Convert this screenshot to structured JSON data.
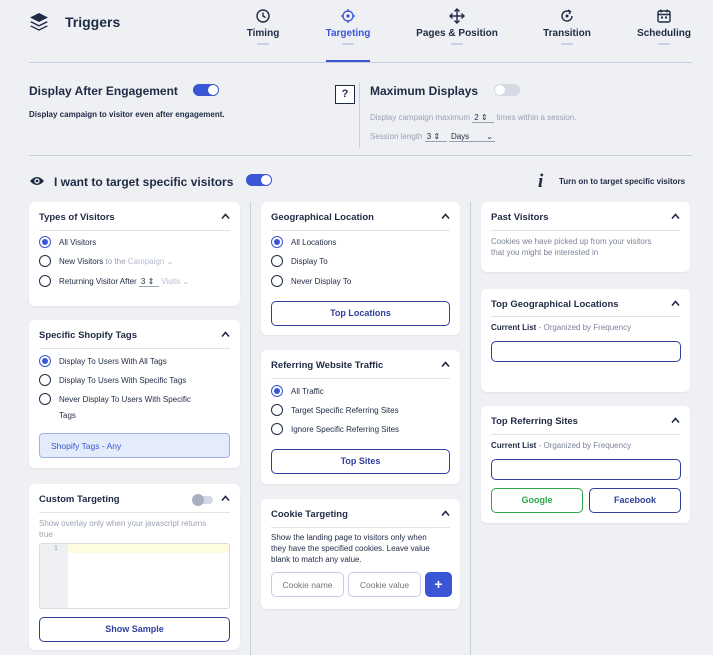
{
  "header": {
    "title": "Triggers",
    "tabs": [
      {
        "label": "Timing"
      },
      {
        "label": "Targeting"
      },
      {
        "label": "Pages & Position"
      },
      {
        "label": "Transition"
      },
      {
        "label": "Scheduling"
      }
    ],
    "active_tab": "Targeting"
  },
  "engagement": {
    "title": "Display After Engagement",
    "enabled": true,
    "description": "Display campaign to visitor even after engagement.",
    "help": "?"
  },
  "max_displays": {
    "title": "Maximum Displays",
    "enabled": false,
    "text_before": "Display campaign maximum",
    "count": "2",
    "text_after": "times within a session.",
    "session_label": "Session length",
    "session_value": "3",
    "session_unit": "Days"
  },
  "targeting": {
    "label": "I want to target specific visitors",
    "enabled": true,
    "info_icon": "i",
    "hint": "Turn on to target specific visitors"
  },
  "types_of_visitors": {
    "title": "Types of Visitors",
    "all": "All Visitors",
    "new": "New Visitors",
    "new_suffix": "to the",
    "new_select": "Campaign",
    "returning": "Returning Visitor",
    "after": "After",
    "after_value": "3",
    "visits": "Visits"
  },
  "shopify_tags": {
    "title": "Specific Shopify Tags",
    "options": [
      "Display To Users With All Tags",
      "Display To Users With Specific Tags",
      "Never Display To Users With Specific",
      "Tags"
    ],
    "select": "Shopify Tags - Any"
  },
  "custom_targeting": {
    "title": "Custom Targeting",
    "description_l1": "Show overlay only when your javascript returns",
    "description_l2": "true",
    "line_no": "1",
    "button": "Show Sample"
  },
  "geo_location": {
    "title": "Geographical Location",
    "options": [
      "All Locations",
      "Display To",
      "Never Display To"
    ],
    "button": "Top Locations"
  },
  "referring_traffic": {
    "title": "Referring Website Traffic",
    "options": [
      "All Traffic",
      "Target Specific Referring Sites",
      "Ignore Specific Referring Sites"
    ],
    "button": "Top Sites"
  },
  "cookie_targeting": {
    "title": "Cookie Targeting",
    "desc_l1": "Show the landing page to visitors only when",
    "desc_l2": "they have the specified cookies. Leave value",
    "desc_l3": "blank to match any value.",
    "name_placeholder": "Cookie name",
    "value_placeholder": "Cookie value",
    "add": "+"
  },
  "past_visitors": {
    "title": "Past Visitors",
    "desc_l1": "Cookies we have picked up from your visitors",
    "desc_l2": "that you might be interested in"
  },
  "top_geo": {
    "title": "Top Geographical Locations",
    "current": "Current List",
    "organized": "- Organized by Frequency"
  },
  "top_ref": {
    "title": "Top Referring Sites",
    "current": "Current List",
    "organized": "- Organized by Frequency",
    "google": "Google",
    "facebook": "Facebook"
  },
  "colors": {
    "accent": "#3a56d4",
    "navy": "#2e3f9c",
    "google_green": "#2aa84a"
  }
}
